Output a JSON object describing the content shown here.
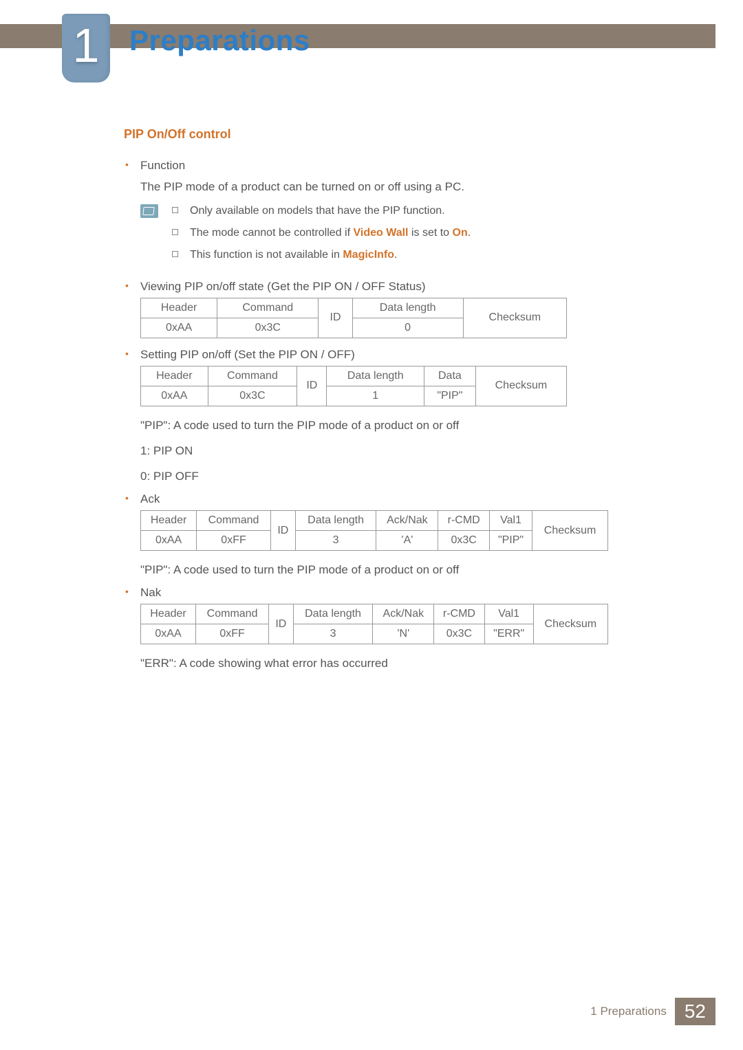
{
  "chapter": {
    "number": "1",
    "title": "Preparations"
  },
  "section": {
    "title": "PIP On/Off control"
  },
  "bullets": {
    "function_label": "Function",
    "function_desc": "The PIP mode of a product can be turned on or off using a PC.",
    "notes": {
      "n1_pre": "Only available on models that have the PIP function.",
      "n2_pre": "The mode cannot be controlled if ",
      "n2_hl1": "Video Wall",
      "n2_mid": " is set to ",
      "n2_hl2": "On",
      "n2_post": ".",
      "n3_pre": "This function is not available in ",
      "n3_hl": "MagicInfo",
      "n3_post": "."
    },
    "viewing_label": "Viewing PIP on/off state (Get the PIP ON / OFF Status)",
    "setting_label": "Setting PIP on/off (Set the PIP ON / OFF)",
    "pip_desc": "\"PIP\": A code used to turn the PIP mode of a product on or off",
    "pip_on": "1: PIP ON",
    "pip_off": "0: PIP OFF",
    "ack_label": "Ack",
    "nak_label": "Nak",
    "err_desc": "\"ERR\": A code showing what error has occurred"
  },
  "labels": {
    "header": "Header",
    "command": "Command",
    "id": "ID",
    "datalen": "Data length",
    "checksum": "Checksum",
    "data": "Data",
    "acknak": "Ack/Nak",
    "rcmd": "r-CMD",
    "val1": "Val1"
  },
  "table_get": {
    "header": "0xAA",
    "command": "0x3C",
    "datalen": "0"
  },
  "table_set": {
    "header": "0xAA",
    "command": "0x3C",
    "datalen": "1",
    "data": "\"PIP\""
  },
  "table_ack": {
    "header": "0xAA",
    "command": "0xFF",
    "datalen": "3",
    "acknak": "'A'",
    "rcmd": "0x3C",
    "val1": "\"PIP\""
  },
  "table_nak": {
    "header": "0xAA",
    "command": "0xFF",
    "datalen": "3",
    "acknak": "'N'",
    "rcmd": "0x3C",
    "val1": "\"ERR\""
  },
  "footer": {
    "label": "1 Preparations",
    "page": "52"
  }
}
